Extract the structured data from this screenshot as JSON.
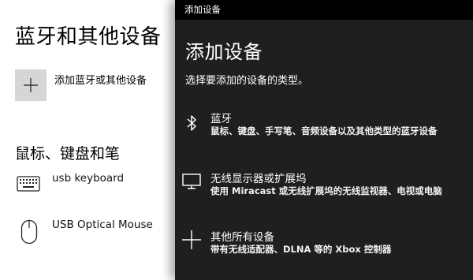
{
  "page": {
    "title": "蓝牙和其他设备",
    "add_device_label": "添加蓝牙或其他设备",
    "section_title": "鼠标、键盘和笔",
    "devices": [
      {
        "name": "usb keyboard",
        "icon": "keyboard-icon"
      },
      {
        "name": "USB Optical Mouse",
        "icon": "mouse-icon"
      }
    ]
  },
  "flyout": {
    "window_title": "添加设备",
    "heading": "添加设备",
    "subtitle": "选择要添加的设备的类型。",
    "options": [
      {
        "title": "蓝牙",
        "description": "鼠标、键盘、手写笔、音频设备以及其他类型的蓝牙设备",
        "icon": "bluetooth-icon"
      },
      {
        "title": "无线显示器或扩展坞",
        "description": "使用 Miracast 或无线扩展坞的无线监视器、电视或电脑",
        "icon": "monitor-icon"
      },
      {
        "title": "其他所有设备",
        "description": "带有无线适配器、DLNA 等的 Xbox 控制器",
        "icon": "plus-icon"
      }
    ]
  },
  "colors": {
    "flyout_bg": "#1f1f1f",
    "titlebar_bg": "#000000",
    "tile_bg": "#d6d6d6"
  }
}
